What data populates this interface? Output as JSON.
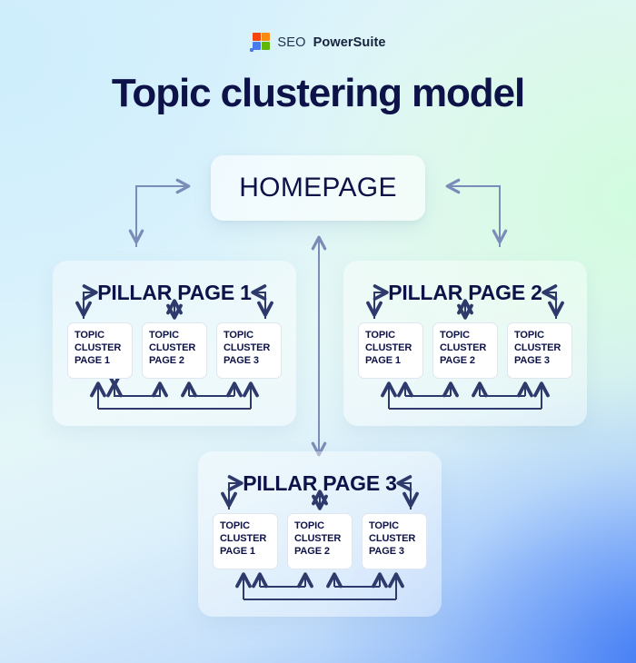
{
  "brand": {
    "logo_icon": "seo-powersuite-logo-icon",
    "name_light": "SEO",
    "name_bold": "PowerSuite",
    "colors": {
      "tile_top_left": "#f4450c",
      "tile_top_right": "#f98b12",
      "tile_bottom_left": "#4a7bec",
      "tile_bottom_right": "#5fb70a"
    }
  },
  "header": {
    "title": "Topic clustering model"
  },
  "theme": {
    "text_navy": "#0d1248",
    "arrow_dark": "#2d3a6b",
    "arrow_light": "#7b8cb8",
    "card_fill": "rgba(255,255,255,0.40)",
    "node_fill": "#ffffff"
  },
  "diagram": {
    "type": "topic-cluster-hub-and-spoke",
    "root": {
      "label": "HOMEPAGE"
    },
    "pillars": [
      {
        "id": "pillar-1",
        "label": "PILLAR PAGE 1",
        "clusters": [
          {
            "line1": "TOPIC",
            "line2": "CLUSTER",
            "line3": "PAGE 1"
          },
          {
            "line1": "TOPIC",
            "line2": "CLUSTER",
            "line3": "PAGE 2"
          },
          {
            "line1": "TOPIC",
            "line2": "CLUSTER",
            "line3": "PAGE 3"
          }
        ]
      },
      {
        "id": "pillar-2",
        "label": "PILLAR PAGE 2",
        "clusters": [
          {
            "line1": "TOPIC",
            "line2": "CLUSTER",
            "line3": "PAGE 1"
          },
          {
            "line1": "TOPIC",
            "line2": "CLUSTER",
            "line3": "PAGE 2"
          },
          {
            "line1": "TOPIC",
            "line2": "CLUSTER",
            "line3": "PAGE 3"
          }
        ]
      },
      {
        "id": "pillar-3",
        "label": "PILLAR PAGE 3",
        "clusters": [
          {
            "line1": "TOPIC",
            "line2": "CLUSTER",
            "line3": "PAGE 1"
          },
          {
            "line1": "TOPIC",
            "line2": "CLUSTER",
            "line3": "PAGE 2"
          },
          {
            "line1": "TOPIC",
            "line2": "CLUSTER",
            "line3": "PAGE 3"
          }
        ]
      }
    ],
    "connectors": [
      {
        "from": "homepage",
        "to": "pillar-1",
        "style": "elbow-fork",
        "direction": "one-way"
      },
      {
        "from": "homepage",
        "to": "pillar-2",
        "style": "elbow-fork",
        "direction": "one-way"
      },
      {
        "from": "homepage",
        "to": "pillar-3",
        "style": "straight",
        "direction": "two-way"
      },
      {
        "from": "pillar",
        "to": "cluster-1",
        "style": "elbow-fork",
        "direction": "one-way"
      },
      {
        "from": "pillar",
        "to": "cluster-2",
        "style": "straight",
        "direction": "two-way"
      },
      {
        "from": "pillar",
        "to": "cluster-3",
        "style": "elbow-fork",
        "direction": "one-way"
      },
      {
        "from": "cluster-1",
        "to": "cluster-2",
        "style": "u-link",
        "direction": "two-way"
      },
      {
        "from": "cluster-2",
        "to": "cluster-3",
        "style": "u-link",
        "direction": "two-way"
      },
      {
        "from": "cluster-1",
        "to": "cluster-3",
        "style": "u-link-wide",
        "direction": "two-way"
      }
    ]
  }
}
